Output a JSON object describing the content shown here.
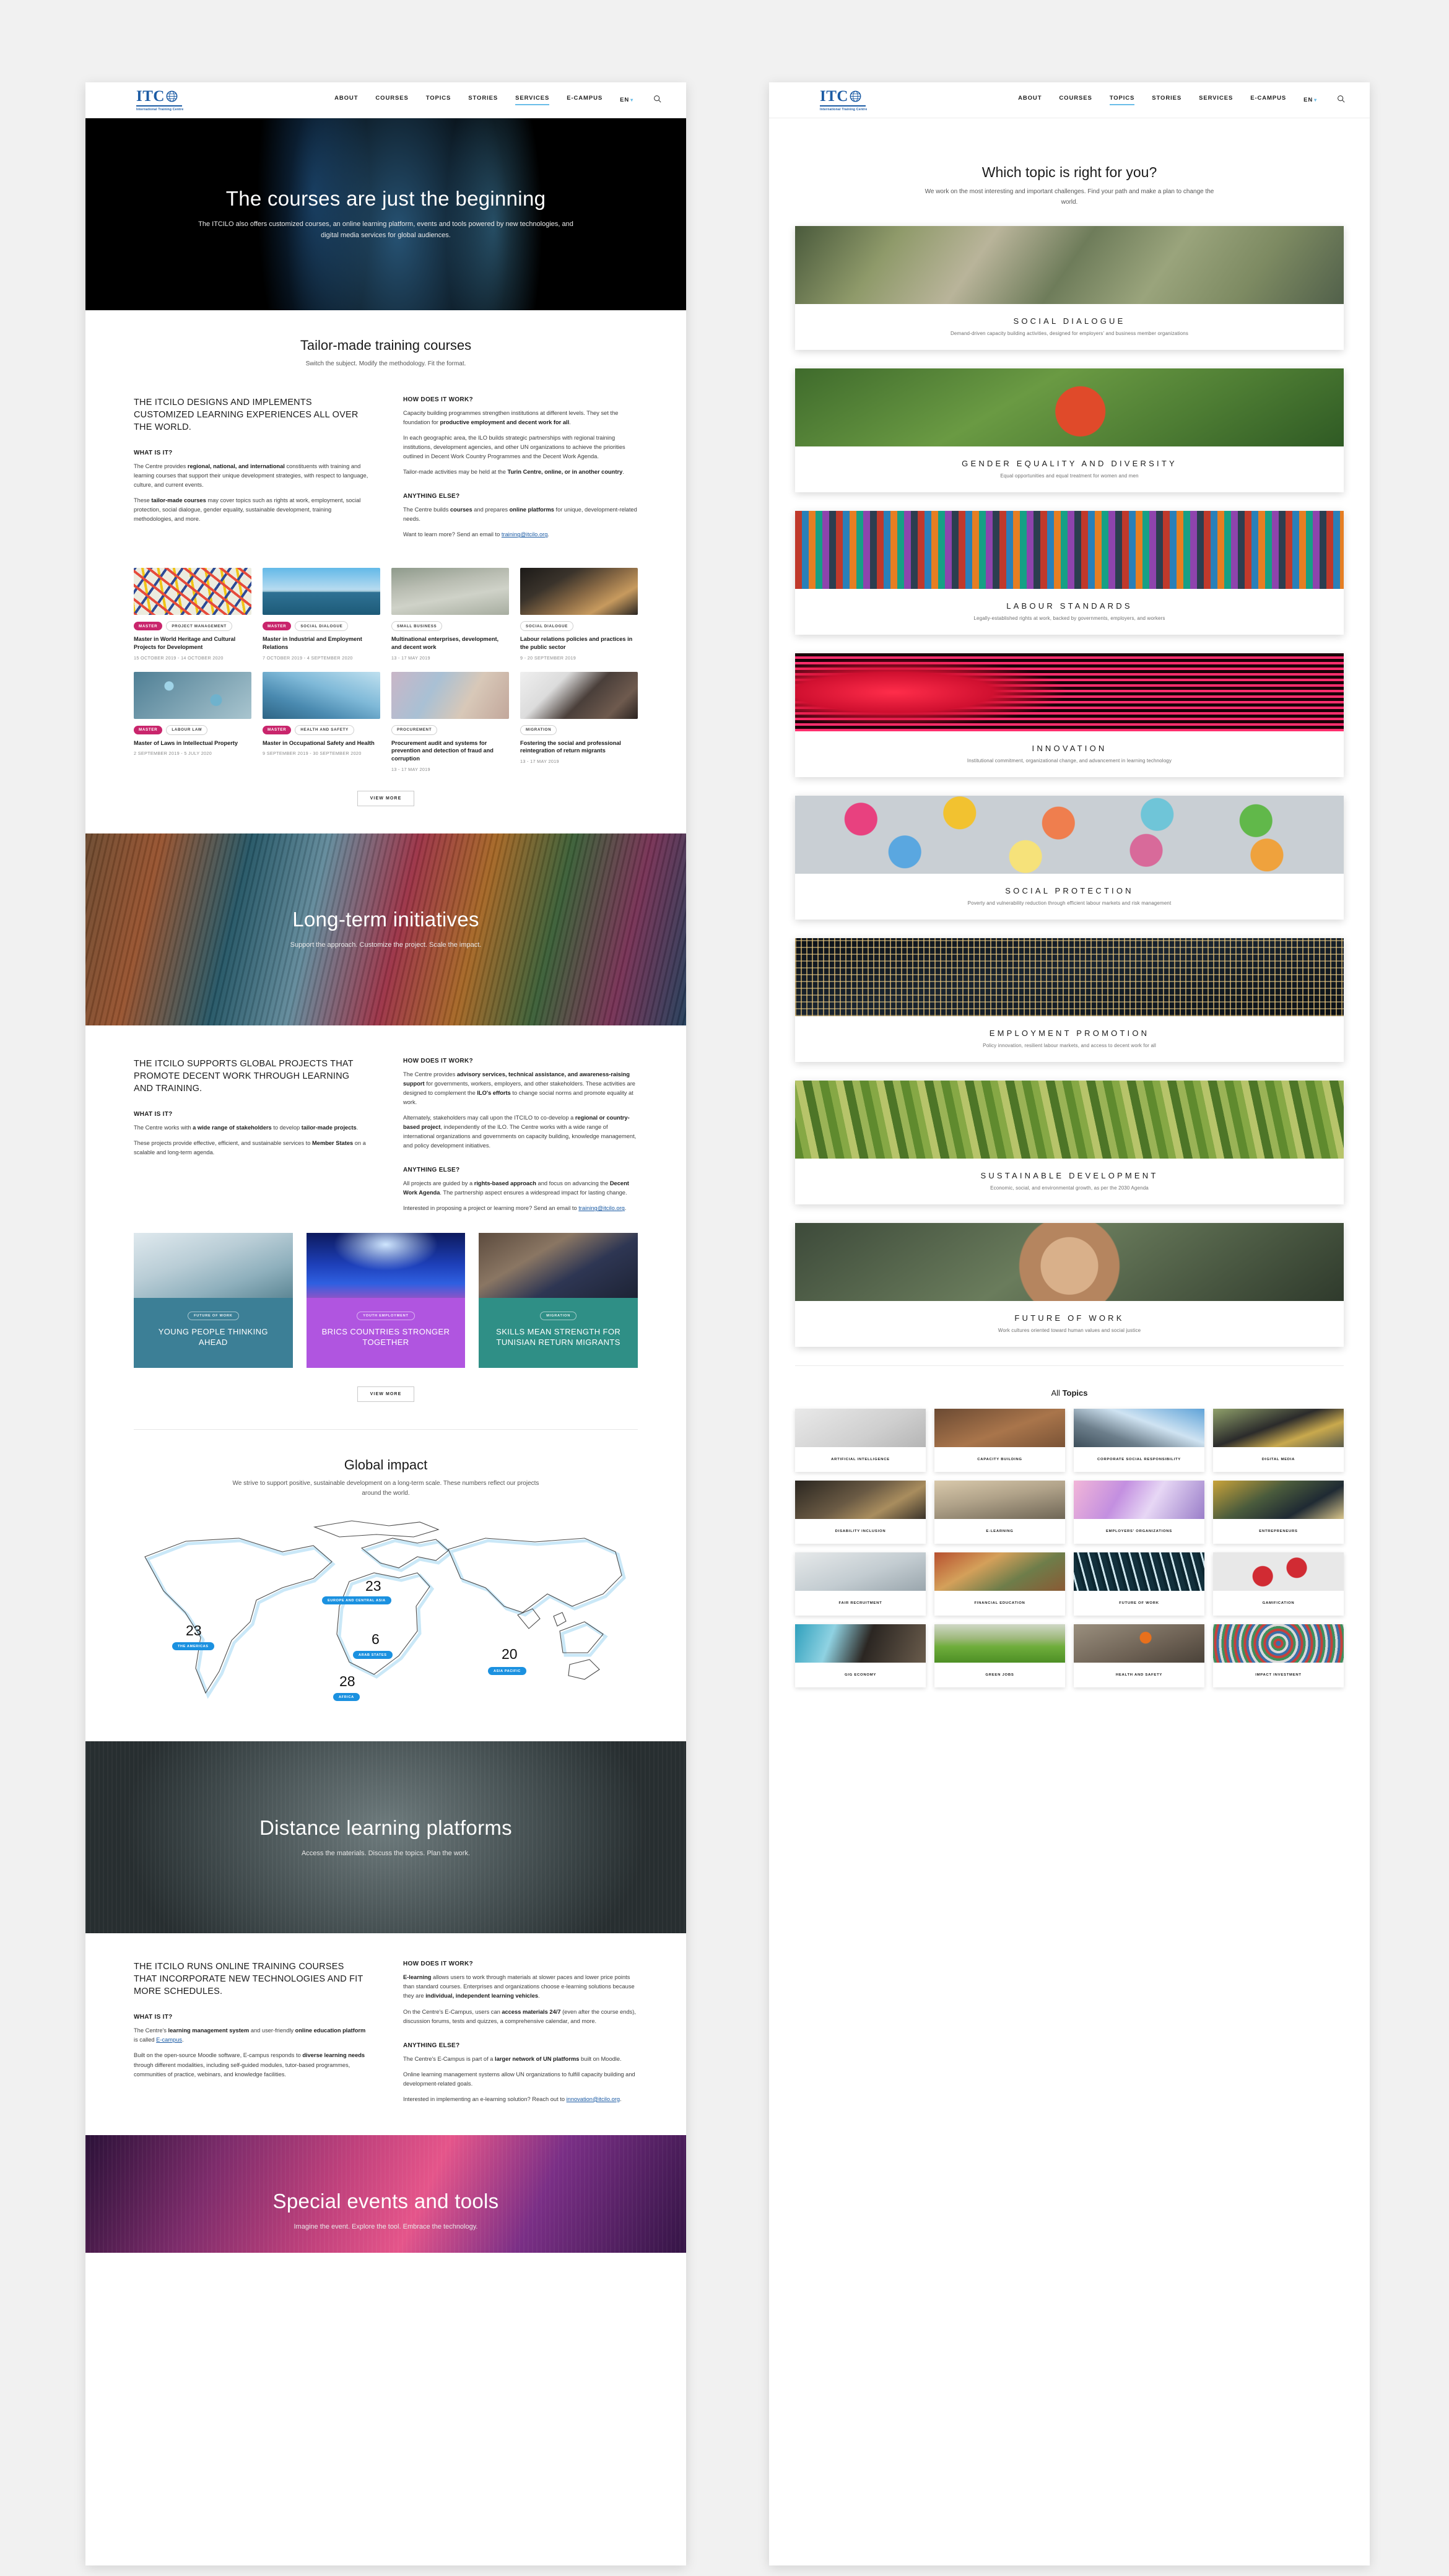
{
  "nav": {
    "logo": {
      "title": "ITC",
      "subtitle": "International Training Centre"
    },
    "links": [
      "ABOUT",
      "COURSES",
      "TOPICS",
      "STORIES",
      "SERVICES",
      "E-CAMPUS"
    ],
    "language": "EN",
    "search_icon": "search-icon",
    "left_active": "SERVICES",
    "right_active": "TOPICS"
  },
  "left": {
    "hero": {
      "title": "The courses are just the beginning",
      "subtitle": "The ITCILO also offers customized courses, an online learning platform, events and tools powered by new technologies, and digital media services for global audiences."
    },
    "tailor": {
      "title": "Tailor-made training courses",
      "subtitle": "Switch the subject. Modify the methodology. Fit the format.",
      "lead": "THE ITCILO DESIGNS AND IMPLEMENTS CUSTOMIZED LEARNING EXPERIENCES ALL OVER THE WORLD.",
      "what_head": "WHAT IS IT?",
      "what_p1_a": "The Centre provides ",
      "what_p1_b": "regional, national, and international",
      "what_p1_c": " constituents with training and learning courses that support their unique development strategies, with respect to language, culture, and current events.",
      "what_p2_a": "These ",
      "what_p2_b": "tailor-made courses",
      "what_p2_c": " may cover topics such as rights at work, employment, social protection, social dialogue, gender equality, sustainable development, training methodologies, and more.",
      "how_head": "HOW DOES IT WORK?",
      "how_p1_a": "Capacity building programmes strengthen institutions at different levels. They set the foundation for ",
      "how_p1_b": "productive employment and decent work for all",
      "how_p1_c": ".",
      "how_p2": "In each geographic area, the ILO builds strategic partnerships with regional training institutions, development agencies, and other UN organizations to achieve the priorities outlined in Decent Work Country Programmes and the Decent Work Agenda.",
      "how_p3_a": "Tailor-made activities may be held at the ",
      "how_p3_b": "Turin Centre, online, or in another country",
      "how_p3_c": ".",
      "else_head": "ANYTHING ELSE?",
      "else_p1_a": "The Centre builds ",
      "else_p1_b": "courses",
      "else_p1_c": " and prepares ",
      "else_p1_d": "online platforms",
      "else_p1_e": " for unique, development-related needs.",
      "else_p2_a": "Want to learn more? Send an email to ",
      "else_p2_link": "training@itcilo.org",
      "else_p2_c": ".",
      "view_more": "VIEW MORE"
    },
    "courses": [
      {
        "pill_master": "MASTER",
        "pill": "PROJECT MANAGEMENT",
        "title": "Master in World Heritage and Cultural Projects for Development",
        "date": "15 OCTOBER 2019 - 14 OCTOBER 2020",
        "img": "confetti"
      },
      {
        "pill_master": "MASTER",
        "pill": "SOCIAL DIALOGUE",
        "title": "Master in Industrial and Employment Relations",
        "date": "7 OCTOBER 2019 - 4 SEPTEMBER 2020",
        "img": "sea"
      },
      {
        "pill_master": "",
        "pill": "SMALL BUSINESS",
        "title": "Multinational enterprises, development, and decent work",
        "date": "13 - 17 MAY 2019",
        "img": "site"
      },
      {
        "pill_master": "",
        "pill": "SOCIAL DIALOGUE",
        "title": "Labour relations policies and practices in the public sector",
        "date": "9 - 20 SEPTEMBER 2019",
        "img": "desk"
      },
      {
        "pill_master": "MASTER",
        "pill": "LABOUR LAW",
        "title": "Master of Laws in Intellectual Property",
        "date": "2 SEPTEMBER 2019 - 5 JULY 2020",
        "img": "drops"
      },
      {
        "pill_master": "MASTER",
        "pill": "HEALTH AND SAFETY",
        "title": "Master in Occupational Safety and Health",
        "date": "9 SEPTEMBER 2019 - 30 SEPTEMBER 2020",
        "img": "glass"
      },
      {
        "pill_master": "",
        "pill": "PROCUREMENT",
        "title": "Procurement audit and systems for prevention and detection of fraud and corruption",
        "date": "13 - 17 MAY 2019",
        "img": "lab"
      },
      {
        "pill_master": "",
        "pill": "MIGRATION",
        "title": "Fostering the social and professional reintegration of return migrants",
        "date": "13 - 17 MAY 2019",
        "img": "coffee"
      }
    ],
    "longterm": {
      "hero_title": "Long-term initiatives",
      "hero_subtitle": "Support the approach. Customize the project. Scale the impact.",
      "lead": "THE ITCILO SUPPORTS GLOBAL PROJECTS THAT PROMOTE DECENT WORK THROUGH LEARNING AND TRAINING.",
      "what_head": "WHAT IS IT?",
      "what_p1_a": "The Centre works with ",
      "what_p1_b": "a wide range of stakeholders",
      "what_p1_c": " to develop ",
      "what_p1_d": "tailor-made projects",
      "what_p1_e": ".",
      "what_p2_a": "These projects provide effective, efficient, and sustainable services to ",
      "what_p2_b": "Member States",
      "what_p2_c": " on a scalable and long-term agenda.",
      "how_head": "HOW DOES IT WORK?",
      "how_p1_a": "The Centre provides ",
      "how_p1_b": "advisory services, technical assistance, and awareness-raising support",
      "how_p1_c": " for governments, workers, employers, and other stakeholders. These activities are designed to complement the ",
      "how_p1_d": "ILO's efforts",
      "how_p1_e": " to change social norms and promote equality at work.",
      "how_p2_a": "Alternately, stakeholders may call upon the ITCILO to co-develop a ",
      "how_p2_b": "regional or country-based project",
      "how_p2_c": ", independently of the ILO. The Centre works with a wide range of international organizations and governments on capacity building, knowledge management, and policy development initiatives.",
      "else_head": "ANYTHING ELSE?",
      "else_p1_a": "All projects are guided by a ",
      "else_p1_b": "rights-based approach",
      "else_p1_c": " and focus on advancing the ",
      "else_p1_d": "Decent Work Agenda",
      "else_p1_e": ". The partnership aspect ensures a widespread impact for lasting change.",
      "else_p2_a": "Interested in proposing a project or learning more? Send an email to ",
      "else_p2_link": "training@itcilo.org",
      "else_p2_c": ".",
      "view_more": "VIEW MORE"
    },
    "initiatives": [
      {
        "tag": "FUTURE OF WORK",
        "title": "YOUNG PEOPLE THINKING AHEAD",
        "color": "bg-teal",
        "img": "library"
      },
      {
        "tag": "YOUTH EMPLOYMENT",
        "title": "BRICS COUNTRIES STRONGER TOGETHER",
        "color": "bg-purple",
        "img": "fiber"
      },
      {
        "tag": "MIGRATION",
        "title": "SKILLS MEAN STRENGTH FOR TUNISIAN RETURN MIGRANTS",
        "color": "bg-green",
        "img": "workshop"
      }
    ],
    "impact": {
      "title": "Global impact",
      "subtitle": "We strive to support positive, sustainable development on a long-term scale. These numbers reflect our projects around the world.",
      "regions": [
        {
          "value": "23",
          "label": "THE AMERICAS"
        },
        {
          "value": "23",
          "label": "EUROPE AND CENTRAL ASIA"
        },
        {
          "value": "6",
          "label": "ARAB STATES"
        },
        {
          "value": "28",
          "label": "AFRICA"
        },
        {
          "value": "20",
          "label": "ASIA PACIFIC"
        }
      ]
    },
    "distance": {
      "hero_title": "Distance learning platforms",
      "hero_subtitle": "Access the materials. Discuss the topics. Plan the work.",
      "lead": "THE ITCILO RUNS ONLINE TRAINING COURSES THAT INCORPORATE NEW TECHNOLOGIES AND FIT MORE SCHEDULES.",
      "what_head": "WHAT IS IT?",
      "what_p1_a": "The Centre's ",
      "what_p1_b": "learning management system",
      "what_p1_c": " and user-friendly ",
      "what_p1_d": "online education platform",
      "what_p1_e": " is called ",
      "what_p1_link": "E-campus",
      "what_p1_f": ".",
      "what_p2_a": "Built on the open-source Moodle software, E-campus responds to ",
      "what_p2_b": "diverse learning needs",
      "what_p2_c": " through different modalities, including self-guided modules, tutor-based programmes, communities of practice, webinars, and knowledge facilities.",
      "how_head": "HOW DOES IT WORK?",
      "how_p1_a": "E-learning",
      "how_p1_b": " allows users to work through materials at slower paces and lower price points than standard courses. Enterprises and organizations choose e-learning solutions because they are ",
      "how_p1_c": "individual, independent learning vehicles",
      "how_p1_d": ".",
      "how_p2_a": "On the Centre's E-Campus, users can ",
      "how_p2_b": "access materials 24/7",
      "how_p2_c": " (even after the course ends), discussion forums, tests and quizzes, a comprehensive calendar, and more.",
      "else_head": "ANYTHING ELSE?",
      "else_p1_a": "The Centre's E-Campus is part of a ",
      "else_p1_b": "larger network of UN platforms",
      "else_p1_c": " built on Moodle.",
      "else_p2": "Online learning management systems allow UN organizations to fulfill capacity building and development-related goals.",
      "else_p3_a": "Interested in implementing an e-learning solution? Reach out to ",
      "else_p3_link": "innovation@itcilo.org",
      "else_p3_c": "."
    },
    "events": {
      "hero_title": "Special events and tools",
      "hero_subtitle": "Imagine the event. Explore the tool. Embrace the technology."
    }
  },
  "right": {
    "head": {
      "title": "Which topic is right for you?",
      "subtitle": "We work on the most interesting and important challenges. Find your path and make a plan to change the world."
    },
    "topics": [
      {
        "title": "SOCIAL DIALOGUE",
        "subtitle": "Demand-driven capacity building activities, designed for employers' and business member organizations",
        "img": "highway"
      },
      {
        "title": "GENDER EQUALITY AND DIVERSITY",
        "subtitle": "Equal opportunities and equal treatment for women and men",
        "img": "teafield"
      },
      {
        "title": "LABOUR STANDARDS",
        "subtitle": "Legally-established rights at work, backed by governments, employers, and workers",
        "img": "containers"
      },
      {
        "title": "INNOVATION",
        "subtitle": "Institutional commitment, organizational change, and advancement in learning technology",
        "img": "leds"
      },
      {
        "title": "SOCIAL PROTECTION",
        "subtitle": "Poverty and vulnerability reduction through efficient labour markets and risk management",
        "img": "umbrellas"
      },
      {
        "title": "EMPLOYMENT PROMOTION",
        "subtitle": "Policy innovation, resilient labour markets, and access to decent work for all",
        "img": "nightcity"
      },
      {
        "title": "SUSTAINABLE DEVELOPMENT",
        "subtitle": "Economic, social, and environmental growth, as per the 2030 Agenda",
        "img": "fields"
      },
      {
        "title": "FUTURE OF WORK",
        "subtitle": "Work cultures oriented toward human values and social justice",
        "img": "hands"
      }
    ],
    "all_topics_label_a": "All ",
    "all_topics_label_b": "Topics",
    "all_topics": [
      {
        "label": "ARTIFICIAL INTELLIGENCE",
        "img": "robot"
      },
      {
        "label": "CAPACITY BUILDING",
        "img": "chairs"
      },
      {
        "label": "CORPORATE SOCIAL RESPONSIBILITY",
        "img": "skyscraper"
      },
      {
        "label": "DIGITAL MEDIA",
        "img": "tablet"
      },
      {
        "label": "DISABILITY INCLUSION",
        "img": "workshop2"
      },
      {
        "label": "E-LEARNING",
        "img": "benchpeople"
      },
      {
        "label": "EMPLOYERS' ORGANIZATIONS",
        "img": "corridor"
      },
      {
        "label": "ENTREPRENEURS",
        "img": "craft"
      },
      {
        "label": "FAIR RECRUITMENT",
        "img": "clinic"
      },
      {
        "label": "FINANCIAL EDUCATION",
        "img": "market"
      },
      {
        "label": "FUTURE OF WORK",
        "img": "speedlines"
      },
      {
        "label": "GAMIFICATION",
        "img": "dice"
      },
      {
        "label": "GIG ECONOMY",
        "img": "remotework"
      },
      {
        "label": "GREEN JOBS",
        "img": "ricefield"
      },
      {
        "label": "HEALTH AND SAFETY",
        "img": "construction"
      },
      {
        "label": "IMPACT INVESTMENT",
        "img": "ripple"
      }
    ]
  },
  "colors": {
    "brand_blue": "#1b5ba4",
    "accent_light_blue": "#69bde8",
    "master_pink": "#c9256c",
    "map_blue": "#1b91e0"
  }
}
